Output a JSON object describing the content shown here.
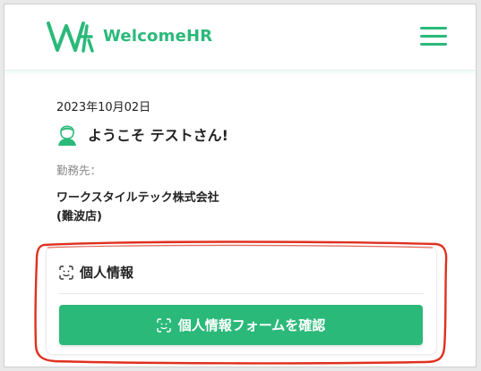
{
  "header": {
    "brand": "WelcomeHR",
    "logo_icon": "welcomehr-logo-icon",
    "menu_icon": "hamburger-menu-icon"
  },
  "greeting": {
    "date": "2023年10月02日",
    "message": "ようこそ テストさん!",
    "avatar_icon": "user-avatar-icon"
  },
  "workplace": {
    "label": "勤務先：",
    "company": "ワークスタイルテック株式会社",
    "branch": "(難波店)"
  },
  "personal_info_card": {
    "title": "個人情報",
    "title_icon": "face-scan-icon",
    "button_label": "個人情報フォームを確認",
    "button_icon": "face-scan-icon"
  },
  "colors": {
    "brand": "#2bb97a",
    "annotation": "#e0301e",
    "text": "#222222",
    "muted": "#888888"
  }
}
